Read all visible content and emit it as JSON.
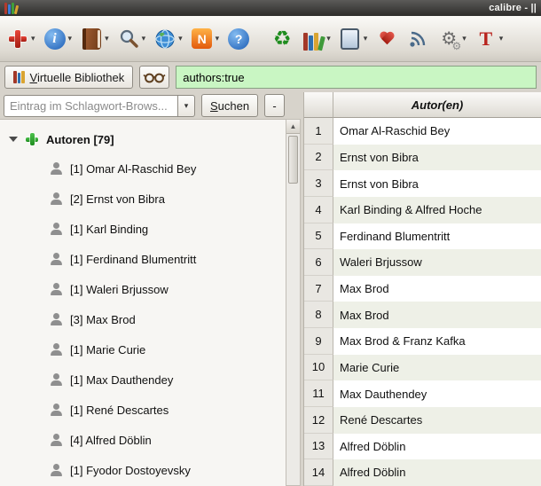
{
  "window": {
    "title": "calibre - ||"
  },
  "icons": {
    "dropdown": "▾",
    "tree_collapse": "▼",
    "scroll_up": "▲",
    "glyph_info": "i",
    "glyph_news": "N",
    "glyph_help": "?",
    "glyph_convert": "♻",
    "glyph_gear": "⚙",
    "glyph_template": "T"
  },
  "library_bar": {
    "virtual_library_accel": "V",
    "virtual_library_rest": "irtuelle Bibliothek",
    "search_value": "authors:true"
  },
  "tag_browser": {
    "filter_placeholder": "Eintrag im Schlagwort-Brows...",
    "search_accel": "S",
    "search_rest": "uchen",
    "minus_label": "-",
    "root_label": "Autoren [79]",
    "items": [
      {
        "label": "[1] Omar Al-Raschid Bey"
      },
      {
        "label": "[2] Ernst von Bibra"
      },
      {
        "label": "[1] Karl Binding"
      },
      {
        "label": "[1] Ferdinand Blumentritt"
      },
      {
        "label": "[1] Waleri Brjussow"
      },
      {
        "label": "[3] Max Brod"
      },
      {
        "label": "[1] Marie Curie"
      },
      {
        "label": "[1] Max Dauthendey"
      },
      {
        "label": "[1] René Descartes"
      },
      {
        "label": "[4] Alfred Döblin"
      },
      {
        "label": "[1] Fyodor Dostoyevsky"
      }
    ]
  },
  "book_list": {
    "author_column_header": "Autor(en)",
    "rows": [
      {
        "n": "1",
        "author": "Omar Al-Raschid Bey"
      },
      {
        "n": "2",
        "author": "Ernst von Bibra"
      },
      {
        "n": "3",
        "author": "Ernst von Bibra"
      },
      {
        "n": "4",
        "author": "Karl Binding & Alfred Hoche"
      },
      {
        "n": "5",
        "author": "Ferdinand Blumentritt"
      },
      {
        "n": "6",
        "author": "Waleri Brjussow"
      },
      {
        "n": "7",
        "author": "Max Brod"
      },
      {
        "n": "8",
        "author": "Max Brod"
      },
      {
        "n": "9",
        "author": "Max Brod & Franz Kafka"
      },
      {
        "n": "10",
        "author": "Marie Curie"
      },
      {
        "n": "11",
        "author": "Max Dauthendey"
      },
      {
        "n": "12",
        "author": "René Descartes"
      },
      {
        "n": "13",
        "author": "Alfred Döblin"
      },
      {
        "n": "14",
        "author": "Alfred Döblin"
      }
    ]
  },
  "colors": {
    "search_bg": "#c9f6c3",
    "accent_green": "#1e8c1e",
    "row_alt": "#eef0e7"
  }
}
